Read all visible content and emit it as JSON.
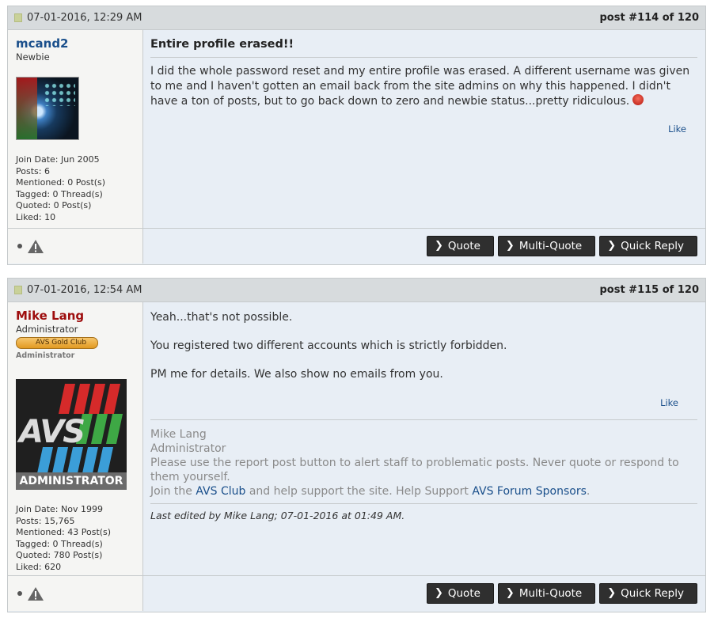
{
  "posts": [
    {
      "date": "07-01-2016, 12:29 AM",
      "post_number": "post #114 of 120",
      "username": "mcand2",
      "user_title": "Newbie",
      "stats": [
        "Join Date: Jun 2005",
        "Posts: 6",
        "Mentioned: 0 Post(s)",
        "Tagged: 0 Thread(s)",
        "Quoted: 0 Post(s)",
        "Liked: 10"
      ],
      "title": "Entire profile erased!!",
      "message": "I did the whole password reset and my entire profile was erased. A different username was given to me and I haven't gotten an email back from the site admins on why this happened. I didn't have a ton of posts, but to go back down to zero and newbie status...pretty ridiculous.",
      "emoji": "mad-face-icon",
      "like_label": "Like"
    },
    {
      "date": "07-01-2016, 12:54 AM",
      "post_number": "post #115 of 120",
      "username": "Mike Lang",
      "user_title": "Administrator",
      "rank_badge": "AVS Gold Club",
      "rank_subtitle": "Administrator",
      "avatar_text": "AVS",
      "avatar_caption": "ADMINISTRATOR",
      "stats": [
        "Join Date: Nov 1999",
        "Posts: 15,765",
        "Mentioned: 43 Post(s)",
        "Tagged: 0 Thread(s)",
        "Quoted: 780 Post(s)",
        "Liked: 620"
      ],
      "message_lines": [
        "Yeah...that's not possible.",
        "You registered two different accounts which is strictly forbidden.",
        "PM me for details. We also show no emails from you."
      ],
      "like_label": "Like",
      "signature": {
        "name": "Mike Lang",
        "role": "Administrator",
        "notice": "Please use the report post button to alert staff to problematic posts. Never quote or respond to them yourself.",
        "join_prefix": "Join the ",
        "club_link": "AVS Club",
        "join_middle": " and help support the site. Help Support ",
        "sponsors_link": "AVS Forum Sponsors",
        "join_suffix": "."
      },
      "edited": "Last edited by Mike Lang; 07-01-2016 at 01:49 AM."
    }
  ],
  "actions": {
    "quote": "Quote",
    "multi_quote": "Multi-Quote",
    "quick_reply": "Quick Reply"
  },
  "colors": {
    "header_bg": "#d7dbdd",
    "content_bg": "#e8eef5",
    "user_bg": "#f5f5f3",
    "link": "#1a4f8b",
    "admin_name": "#9e0e0e",
    "button_bg": "#2f2f2f"
  }
}
